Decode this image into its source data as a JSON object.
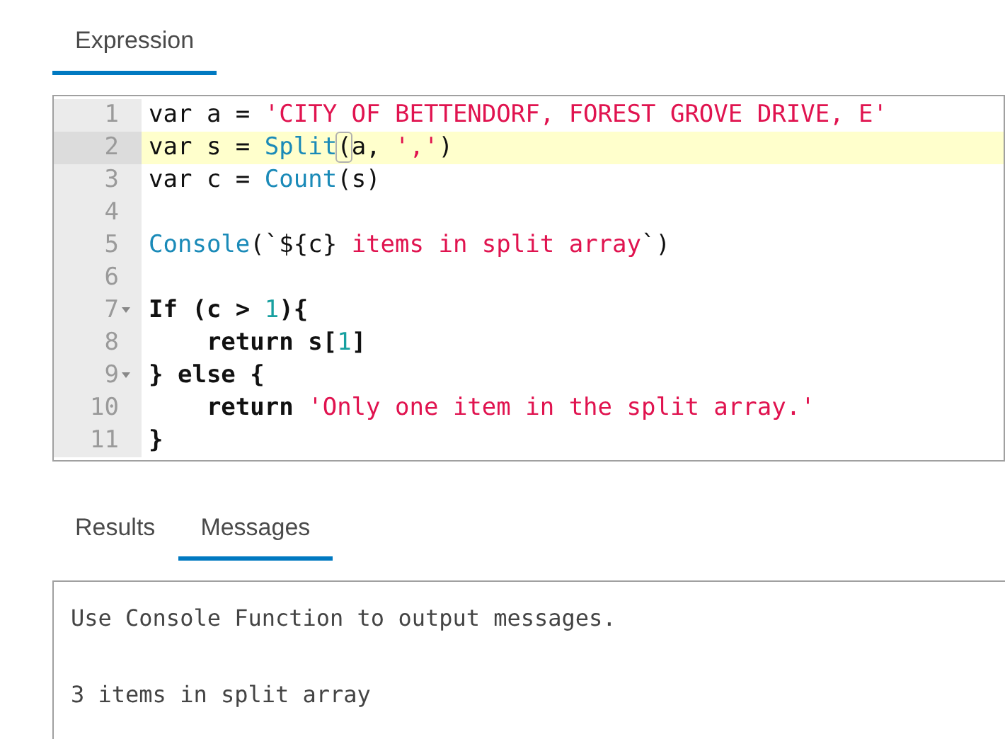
{
  "expression_tabs": [
    {
      "label": "Expression",
      "selected": true
    }
  ],
  "editor": {
    "lines": [
      {
        "number": "1",
        "active": false,
        "foldable": false,
        "tokens": [
          {
            "kind": "plain",
            "text": "var a = "
          },
          {
            "kind": "string",
            "text": "'CITY OF BETTENDORF, FOREST GROVE DRIVE, E'"
          }
        ]
      },
      {
        "number": "2",
        "active": true,
        "foldable": false,
        "tokens": [
          {
            "kind": "plain",
            "text": "var s = "
          },
          {
            "kind": "func",
            "text": "Split"
          },
          {
            "kind": "plain",
            "text": "(",
            "matched": true
          },
          {
            "kind": "plain",
            "text": "a, "
          },
          {
            "kind": "string",
            "text": "','"
          },
          {
            "kind": "plain",
            "text": ")"
          }
        ]
      },
      {
        "number": "3",
        "active": false,
        "foldable": false,
        "tokens": [
          {
            "kind": "plain",
            "text": "var c = "
          },
          {
            "kind": "func",
            "text": "Count"
          },
          {
            "kind": "plain",
            "text": "(s)"
          }
        ]
      },
      {
        "number": "4",
        "active": false,
        "foldable": false
      },
      {
        "number": "5",
        "active": false,
        "foldable": false,
        "tokens": [
          {
            "kind": "func",
            "text": "Console"
          },
          {
            "kind": "plain",
            "text": "(`${c}"
          },
          {
            "kind": "string",
            "text": " items in split array"
          },
          {
            "kind": "plain",
            "text": "`)"
          }
        ]
      },
      {
        "number": "6",
        "active": false,
        "foldable": false
      },
      {
        "number": "7",
        "active": false,
        "foldable": true,
        "tokens": [
          {
            "kind": "keyword",
            "text": "If (c > "
          },
          {
            "kind": "number",
            "text": "1"
          },
          {
            "kind": "keyword",
            "text": "){"
          }
        ]
      },
      {
        "number": "8",
        "active": false,
        "foldable": false,
        "tokens": [
          {
            "kind": "keyword",
            "text": "    return s["
          },
          {
            "kind": "number",
            "text": "1"
          },
          {
            "kind": "keyword",
            "text": "]"
          }
        ]
      },
      {
        "number": "9",
        "active": false,
        "foldable": true,
        "tokens": [
          {
            "kind": "keyword",
            "text": "} else {"
          }
        ]
      },
      {
        "number": "10",
        "active": false,
        "foldable": false,
        "tokens": [
          {
            "kind": "keyword",
            "text": "    return "
          },
          {
            "kind": "string",
            "text": "'Only one item in the split array.'"
          }
        ]
      },
      {
        "number": "11",
        "active": false,
        "foldable": false,
        "tokens": [
          {
            "kind": "keyword",
            "text": "}"
          }
        ]
      }
    ]
  },
  "output_tabs": [
    {
      "label": "Results",
      "selected": false
    },
    {
      "label": "Messages",
      "selected": true
    }
  ],
  "messages": [
    "Use Console Function to output messages.",
    "3 items in split array"
  ]
}
